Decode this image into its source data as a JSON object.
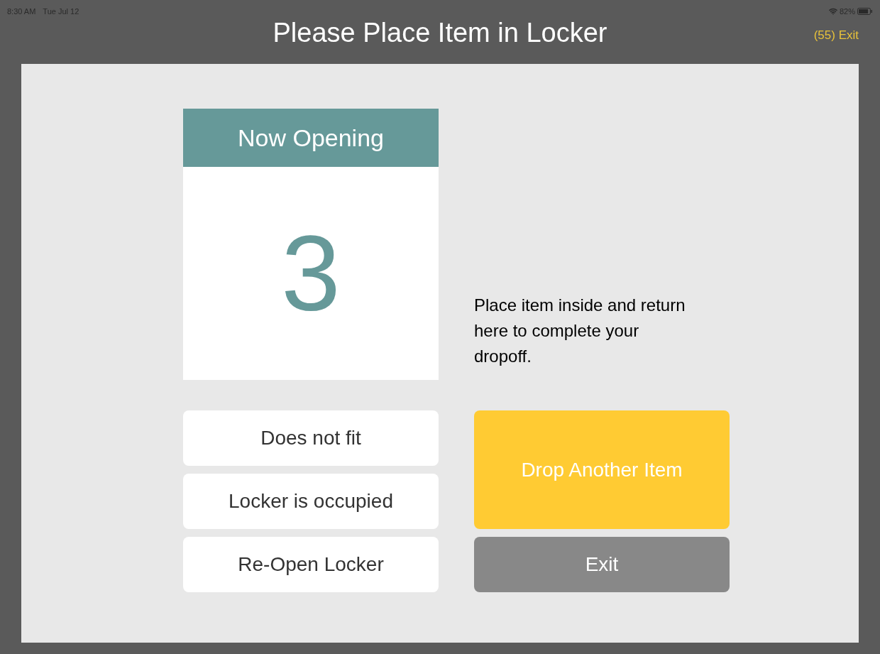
{
  "status_bar": {
    "time": "8:30 AM",
    "date": "Tue Jul 12",
    "battery": "82%"
  },
  "header": {
    "title": "Please Place Item in Locker",
    "exit_link": "(55) Exit"
  },
  "locker_card": {
    "heading": "Now Opening",
    "number": "3"
  },
  "instructions": "Place item inside and return here to complete your dropoff.",
  "issue_buttons": [
    "Does not fit",
    "Locker is occupied",
    "Re-Open Locker"
  ],
  "actions": [
    {
      "label": "Drop Another Item",
      "kind": "primary"
    },
    {
      "label": "Exit",
      "kind": "secondary"
    }
  ]
}
